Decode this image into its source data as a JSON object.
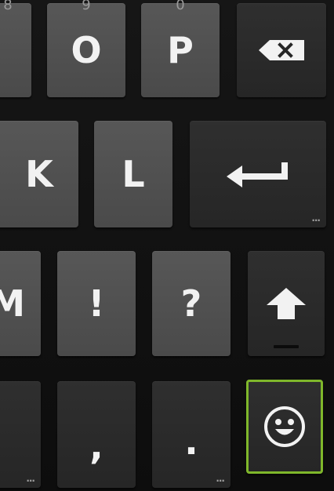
{
  "keyboard": {
    "row1": {
      "key_i": {
        "label": "",
        "hint": "8"
      },
      "key_o": {
        "label": "O",
        "hint": "9"
      },
      "key_p": {
        "label": "P",
        "hint": "0"
      },
      "backspace": {
        "icon": "backspace-icon"
      }
    },
    "row2": {
      "key_k": {
        "label": "K"
      },
      "key_l": {
        "label": "L"
      },
      "enter": {
        "icon": "enter-arrow-icon",
        "more": "..."
      }
    },
    "row3": {
      "key_m": {
        "label": "M"
      },
      "key_exclaim": {
        "label": "!"
      },
      "key_question": {
        "label": "?"
      },
      "shift": {
        "icon": "shift-arrow-icon"
      }
    },
    "row4": {
      "key_left": {
        "more": "..."
      },
      "key_comma": {
        "label": ","
      },
      "key_period": {
        "label": ".",
        "more": "..."
      },
      "emoji": {
        "icon": "smiley-icon",
        "focused": true
      }
    },
    "colors": {
      "focus_outline": "#7fb72b",
      "key_light": "#505050",
      "key_dark": "#2a2a2a"
    }
  }
}
